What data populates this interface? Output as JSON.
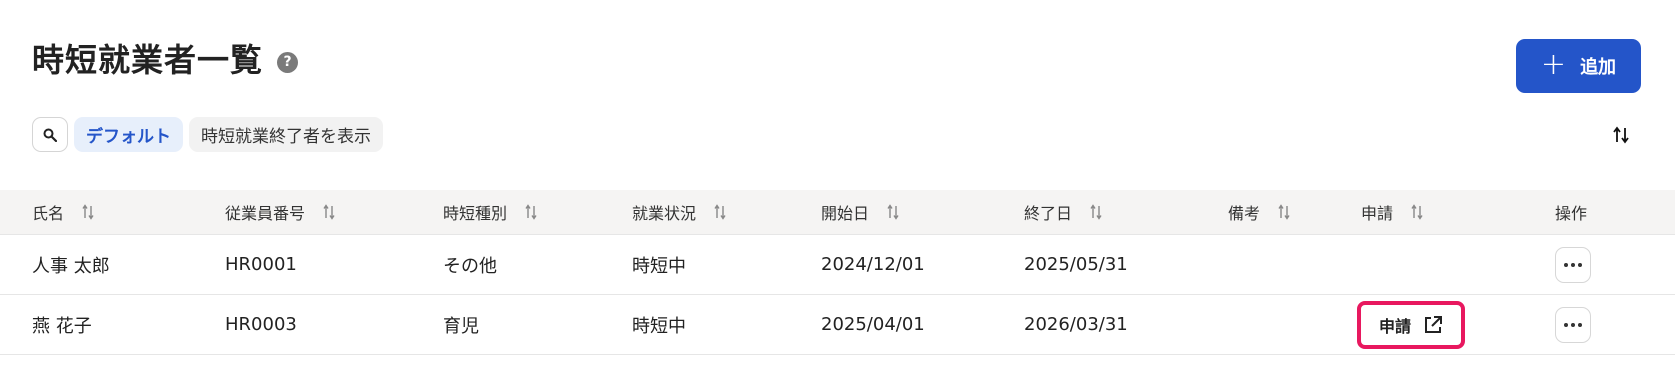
{
  "page": {
    "title": "時短就業者一覧",
    "help_icon": "?",
    "add_button_icon": "+",
    "add_button_label": "追加"
  },
  "filters": {
    "search_icon": "search-icon",
    "chips": [
      {
        "label": "デフォルト",
        "active": true
      },
      {
        "label": "時短就業終了者を表示",
        "active": false
      }
    ]
  },
  "table": {
    "headers": [
      "氏名",
      "従業員番号",
      "時短種別",
      "就業状況",
      "開始日",
      "終了日",
      "備考",
      "申請",
      "操作"
    ],
    "rows": [
      {
        "name": "人事 太郎",
        "employee_no": "HR0001",
        "type": "その他",
        "status": "時短中",
        "start": "2024/12/01",
        "end": "2025/05/31",
        "note": "",
        "apply": ""
      },
      {
        "name": "燕 花子",
        "employee_no": "HR0003",
        "type": "育児",
        "status": "時短中",
        "start": "2025/04/01",
        "end": "2026/03/31",
        "note": "",
        "apply": "申請"
      }
    ]
  },
  "colors": {
    "primary": "#2455c9",
    "highlight": "#e8185f",
    "header_bg": "#f5f4f3"
  }
}
